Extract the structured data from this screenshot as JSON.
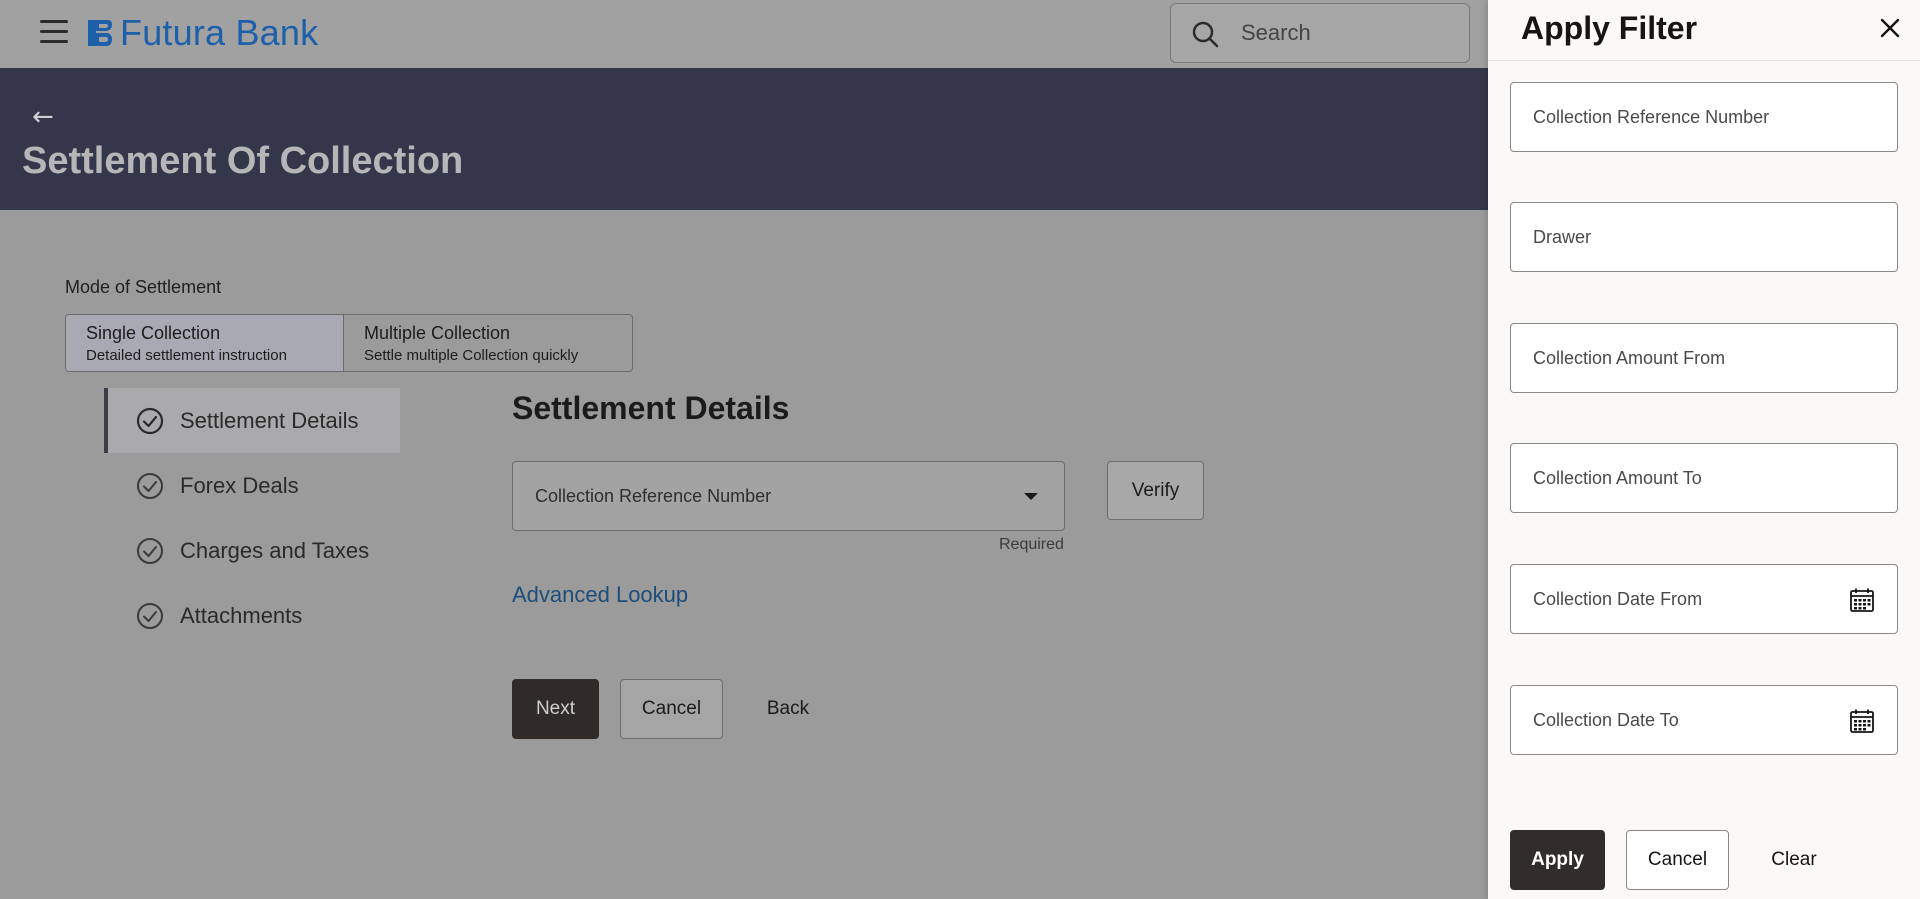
{
  "header": {
    "brand": "Futura Bank",
    "search_placeholder": "Search"
  },
  "hero": {
    "title": "Settlement Of Collection"
  },
  "mode": {
    "label": "Mode of Settlement",
    "options": [
      {
        "title": "Single Collection",
        "subtitle": "Detailed settlement instruction",
        "selected": true
      },
      {
        "title": "Multiple Collection",
        "subtitle": "Settle multiple Collection quickly",
        "selected": false
      }
    ]
  },
  "steps": [
    {
      "label": "Settlement Details",
      "active": true
    },
    {
      "label": "Forex Deals",
      "active": false
    },
    {
      "label": "Charges and Taxes",
      "active": false
    },
    {
      "label": "Attachments",
      "active": false
    }
  ],
  "settlement": {
    "title": "Settlement Details",
    "ref_placeholder": "Collection Reference Number",
    "required_text": "Required",
    "verify_label": "Verify",
    "advanced_lookup": "Advanced Lookup",
    "next_label": "Next",
    "cancel_label": "Cancel",
    "back_label": "Back"
  },
  "filter": {
    "title": "Apply Filter",
    "fields": {
      "collection_ref": "Collection Reference Number",
      "drawer": "Drawer",
      "amount_from": "Collection Amount From",
      "amount_to": "Collection Amount To",
      "date_from": "Collection Date From",
      "date_to": "Collection Date To"
    },
    "apply_label": "Apply",
    "cancel_label": "Cancel",
    "clear_label": "Clear"
  },
  "colors": {
    "brand": "#1d5fa8",
    "hero_bg": "#34374a",
    "primary_button": "#312d2a",
    "link": "#1d4d7a"
  }
}
